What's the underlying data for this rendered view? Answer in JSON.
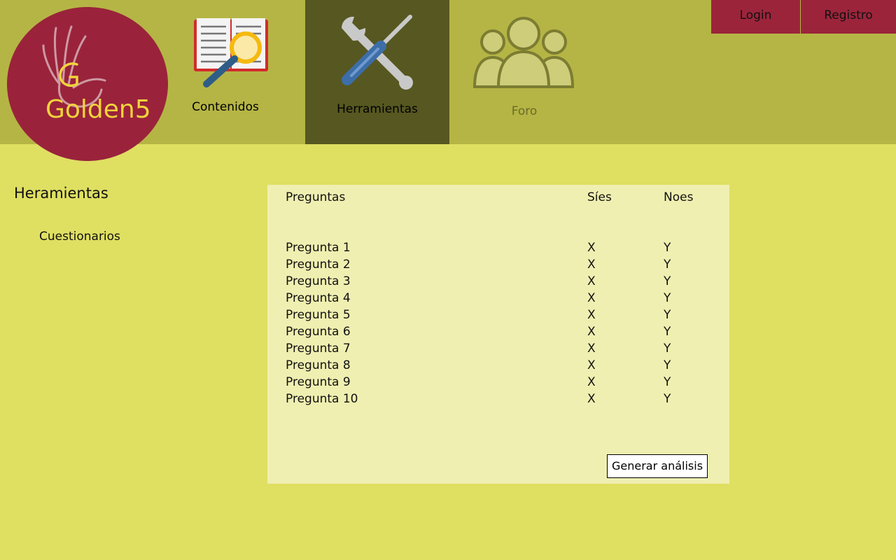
{
  "logo": {
    "text": "Golden5"
  },
  "nav": {
    "contenidos": {
      "label": "Contenidos",
      "icon": "book-magnifier-icon"
    },
    "herramientas": {
      "label": "Herramientas",
      "icon": "wrench-screwdriver-icon"
    },
    "foro": {
      "label": "Foro",
      "icon": "users-group-icon"
    }
  },
  "auth": {
    "login_label": "Login",
    "registro_label": "Registro"
  },
  "sidebar": {
    "title": "Heramientas",
    "items": [
      {
        "label": "Cuestionarios"
      }
    ]
  },
  "table": {
    "headers": {
      "question": "Preguntas",
      "yes": "Síes",
      "no": "Noes"
    },
    "rows": [
      {
        "question": "Pregunta 1",
        "yes": "X",
        "no": "Y"
      },
      {
        "question": "Pregunta 2",
        "yes": "X",
        "no": "Y"
      },
      {
        "question": "Pregunta 3",
        "yes": "X",
        "no": "Y"
      },
      {
        "question": "Pregunta 4",
        "yes": "X",
        "no": "Y"
      },
      {
        "question": "Pregunta 5",
        "yes": "X",
        "no": "Y"
      },
      {
        "question": "Pregunta 6",
        "yes": "X",
        "no": "Y"
      },
      {
        "question": "Pregunta 7",
        "yes": "X",
        "no": "Y"
      },
      {
        "question": "Pregunta 8",
        "yes": "X",
        "no": "Y"
      },
      {
        "question": "Pregunta 9",
        "yes": "X",
        "no": "Y"
      },
      {
        "question": "Pregunta 10",
        "yes": "X",
        "no": "Y"
      }
    ]
  },
  "actions": {
    "generate_label": "Generar análisis"
  },
  "colors": {
    "header_bg": "#b5b545",
    "active_nav_bg": "#575721",
    "page_bg": "#dfdf62",
    "panel_bg": "#efefb1",
    "accent": "#9b243b"
  }
}
